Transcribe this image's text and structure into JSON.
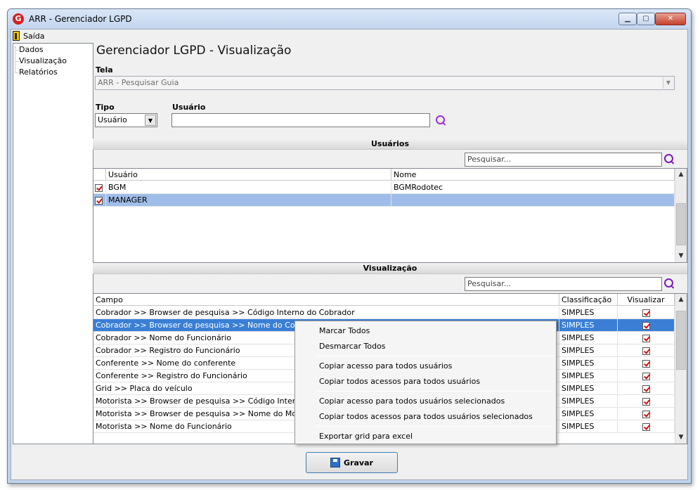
{
  "window": {
    "title": "ARR - Gerenciador LGPD",
    "app_icon": "G"
  },
  "menu": {
    "exit_label": "Saída"
  },
  "tree": {
    "items": [
      {
        "label": "Dados"
      },
      {
        "label": "Visualização"
      },
      {
        "label": "Relatórios"
      }
    ]
  },
  "page": {
    "title": "Gerenciador LGPD - Visualização"
  },
  "tela": {
    "label": "Tela",
    "value": "ARR - Pesquisar Guia"
  },
  "tipo": {
    "label": "Tipo",
    "value": "Usuário"
  },
  "usuario": {
    "label": "Usuário",
    "value": ""
  },
  "usuarios_section": {
    "title": "Usuários",
    "search_placeholder": "Pesquisar...",
    "columns": [
      "Usuário",
      "Nome"
    ],
    "rows": [
      {
        "checked": true,
        "usuario": "BGM",
        "nome": "BGMRodotec"
      },
      {
        "checked": true,
        "usuario": "MANAGER",
        "nome": ""
      }
    ]
  },
  "visualizacao_section": {
    "title": "Visualização",
    "search_placeholder": "Pesquisar...",
    "columns": [
      "Campo",
      "Classificação",
      "Visualizar"
    ],
    "rows": [
      {
        "campo": "Cobrador >> Browser de pesquisa >> Código Interno do Cobrador",
        "classificacao": "SIMPLES",
        "visualizar": true
      },
      {
        "campo": "Cobrador >> Browser de pesquisa >> Nome do Cobrador",
        "classificacao": "SIMPLES",
        "visualizar": true
      },
      {
        "campo": "Cobrador >> Nome do Funcionário",
        "classificacao": "SIMPLES",
        "visualizar": true
      },
      {
        "campo": "Cobrador >> Registro do Funcionário",
        "classificacao": "SIMPLES",
        "visualizar": true
      },
      {
        "campo": "Conferente >> Nome do conferente",
        "classificacao": "SIMPLES",
        "visualizar": true
      },
      {
        "campo": "Conferente >> Registro do Funcionário",
        "classificacao": "SIMPLES",
        "visualizar": true
      },
      {
        "campo": "Grid >> Placa do veículo",
        "classificacao": "SIMPLES",
        "visualizar": true
      },
      {
        "campo": "Motorista >> Browser de pesquisa >> Código Interno do Mo",
        "classificacao": "SIMPLES",
        "visualizar": true
      },
      {
        "campo": "Motorista >> Browser de pesquisa >> Nome do Motorista",
        "classificacao": "SIMPLES",
        "visualizar": true
      },
      {
        "campo": "Motorista >> Nome do Funcionário",
        "classificacao": "SIMPLES",
        "visualizar": true
      }
    ]
  },
  "context_menu": {
    "items": [
      "Marcar Todos",
      "Desmarcar Todos",
      "Copiar acesso para todos usuários",
      "Copiar todos acessos para todos usuários",
      "Copiar acesso para todos usuários selecionados",
      "Copiar todos acessos para todos usuários selecionados",
      "Exportar grid para excel"
    ]
  },
  "save_button": {
    "label": "Gravar"
  },
  "colors": {
    "selection": "#3a7fd5",
    "search_icon": "#9b30d9",
    "check": "#d01010"
  }
}
